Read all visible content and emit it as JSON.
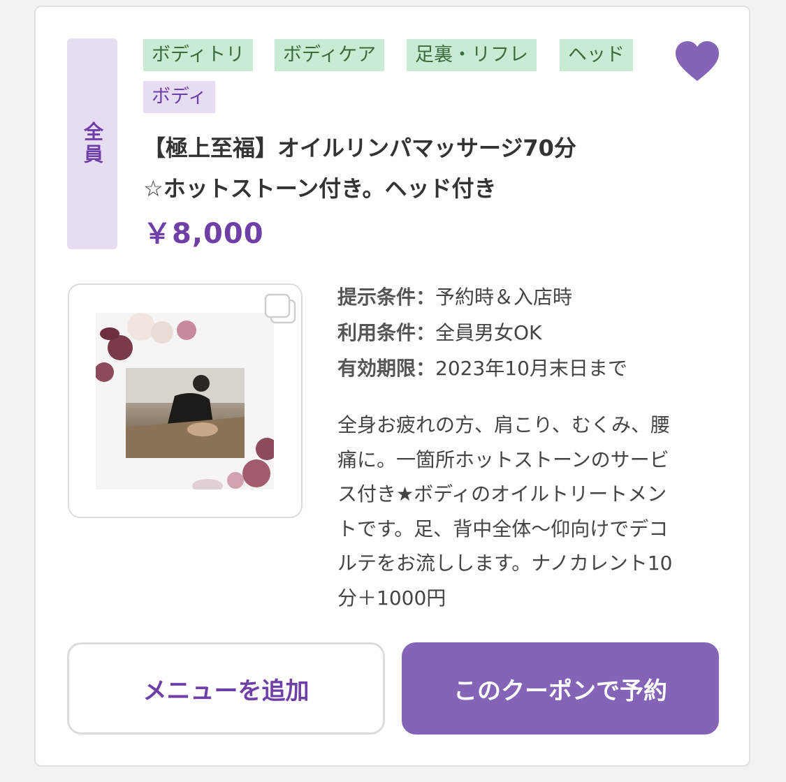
{
  "coupon": {
    "target_badge": "全員",
    "tags": [
      {
        "label": "ボディトリ",
        "color": "green"
      },
      {
        "label": "ボディケア",
        "color": "green"
      },
      {
        "label": "足裏・リフレ",
        "color": "green"
      },
      {
        "label": "ヘッド",
        "color": "green"
      },
      {
        "label": "ボディ",
        "color": "purple"
      }
    ],
    "favorite_icon": "heart-icon",
    "favorited": true,
    "title_line1": "【極上至福】オイルリンパマッサージ70分",
    "title_line2": "☆ホットストーン付き。ヘッド付き",
    "price": "￥8,000",
    "conditions": [
      {
        "label": "提示条件：",
        "value": "予約時＆入店時"
      },
      {
        "label": "利用条件：",
        "value": "全員男女OK"
      },
      {
        "label": "有効期限：",
        "value": "2023年10月末日まで"
      }
    ],
    "description_lines": [
      "全身お疲れの方、肩こり、むくみ、腰",
      "痛に。一箇所ホットストーンのサービ",
      "ス付き★ボディのオイルトリートメン",
      "トです。足、背中全体〜仰向けでデコ",
      "ルテをお流しします。ナノカレント10",
      "分＋1000円"
    ],
    "buttons": {
      "add_menu": "メニューを追加",
      "reserve": "このクーポンで予約"
    }
  },
  "colors": {
    "accent": "#8464b6",
    "accent_text": "#6f3fa8",
    "tag_green_bg": "#c7ecd3",
    "tag_purple_bg": "#e6ddf3"
  }
}
